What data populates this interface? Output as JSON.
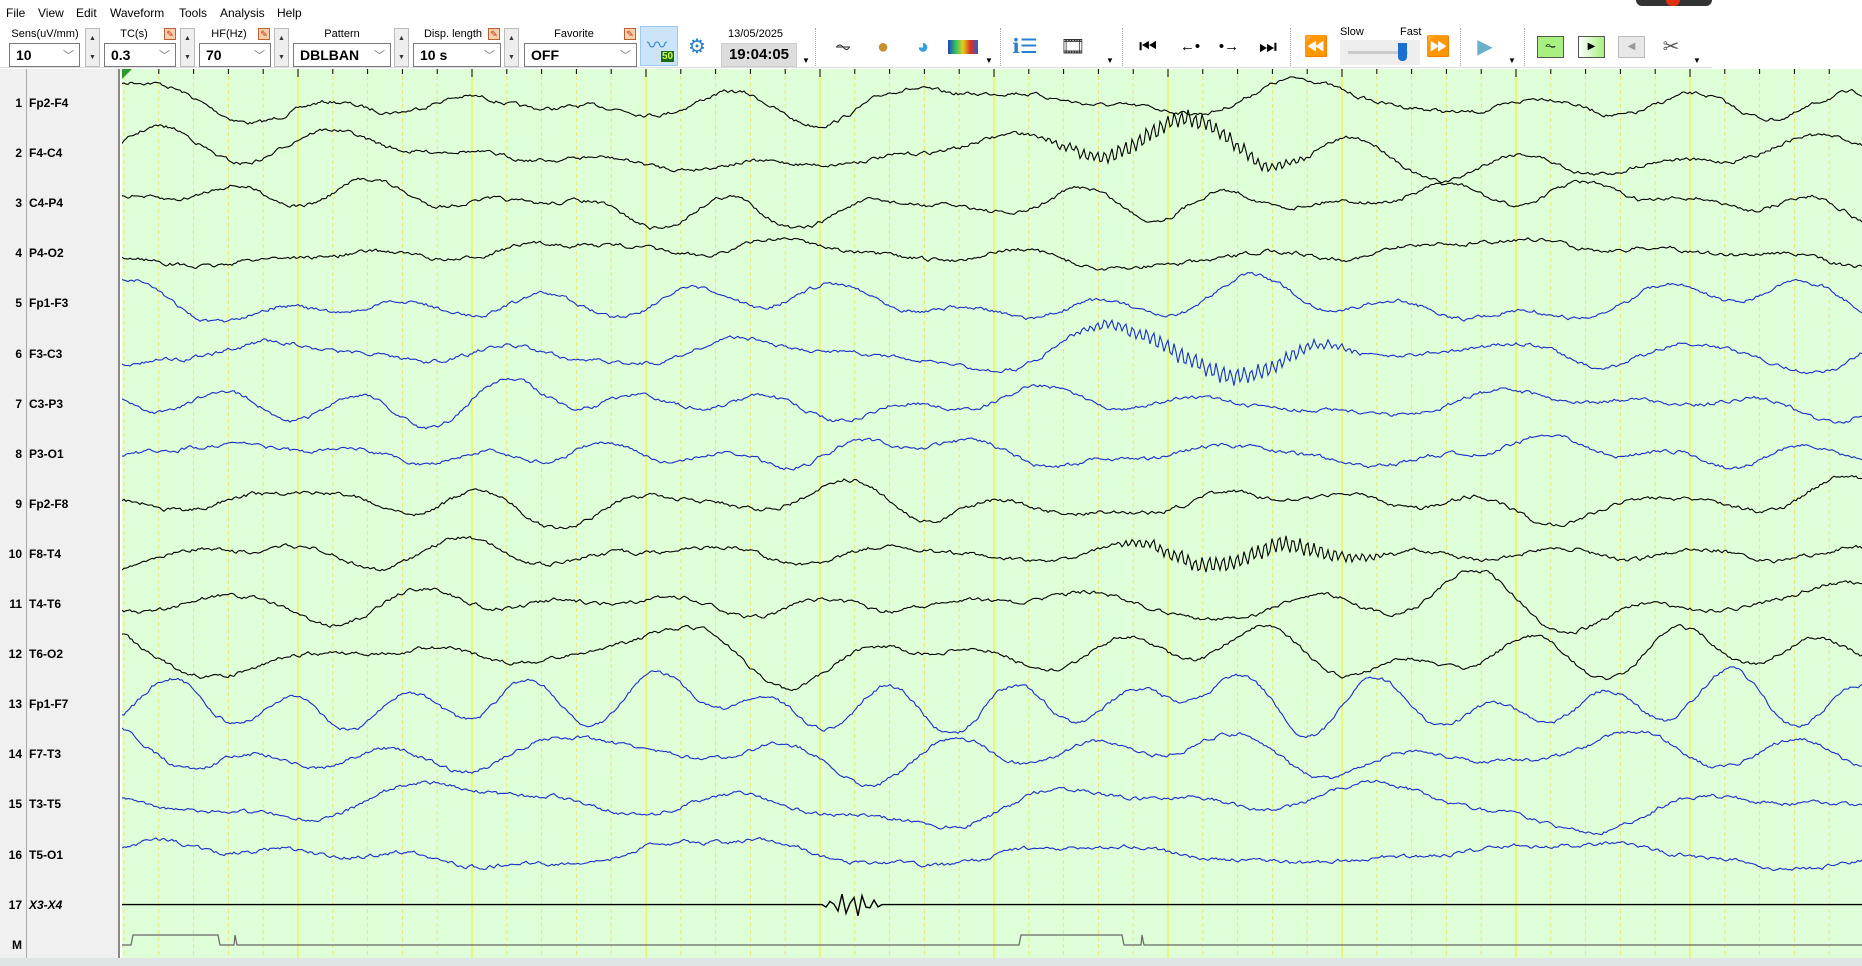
{
  "menu": [
    "File",
    "View",
    "Edit",
    "Waveform",
    "Tools",
    "Analysis",
    "Help"
  ],
  "toolbar": {
    "sens": {
      "label": "Sens(uV/mm)",
      "value": "10"
    },
    "tc": {
      "label": "TC(s)",
      "value": "0.3"
    },
    "hf": {
      "label": "HF(Hz)",
      "value": "70"
    },
    "pattern": {
      "label": "Pattern",
      "value": "DBLBAN"
    },
    "disp": {
      "label": "Disp. length",
      "value": "10 s"
    },
    "favorite": {
      "label": "Favorite",
      "value": "OFF"
    },
    "notch_badge": "50",
    "date": "13/05/2025",
    "time": "19:04:05",
    "speed_slow": "Slow",
    "speed_fast": "Fast"
  },
  "channels": [
    {
      "n": "1",
      "label": "Fp2-F4",
      "color": "#000000"
    },
    {
      "n": "2",
      "label": "F4-C4",
      "color": "#000000"
    },
    {
      "n": "3",
      "label": "C4-P4",
      "color": "#000000"
    },
    {
      "n": "4",
      "label": "P4-O2",
      "color": "#000000"
    },
    {
      "n": "5",
      "label": "Fp1-F3",
      "color": "#1a2fc8"
    },
    {
      "n": "6",
      "label": "F3-C3",
      "color": "#1a2fc8"
    },
    {
      "n": "7",
      "label": "C3-P3",
      "color": "#1a2fc8"
    },
    {
      "n": "8",
      "label": "P3-O1",
      "color": "#1a2fc8"
    },
    {
      "n": "9",
      "label": "Fp2-F8",
      "color": "#000000"
    },
    {
      "n": "10",
      "label": "F8-T4",
      "color": "#000000"
    },
    {
      "n": "11",
      "label": "T4-T6",
      "color": "#000000"
    },
    {
      "n": "12",
      "label": "T6-O2",
      "color": "#000000"
    },
    {
      "n": "13",
      "label": "Fp1-F7",
      "color": "#1a2fc8"
    },
    {
      "n": "14",
      "label": "F7-T3",
      "color": "#1a2fc8"
    },
    {
      "n": "15",
      "label": "T3-T5",
      "color": "#1a2fc8"
    },
    {
      "n": "16",
      "label": "T5-O1",
      "color": "#1a2fc8"
    },
    {
      "n": "17",
      "label": "X3-X4",
      "color": "#000000"
    }
  ],
  "marker_channel": "M",
  "colors": {
    "background": "#dfffd8",
    "grid_second": "#f0f040",
    "grid_sub": "#e8e870"
  }
}
